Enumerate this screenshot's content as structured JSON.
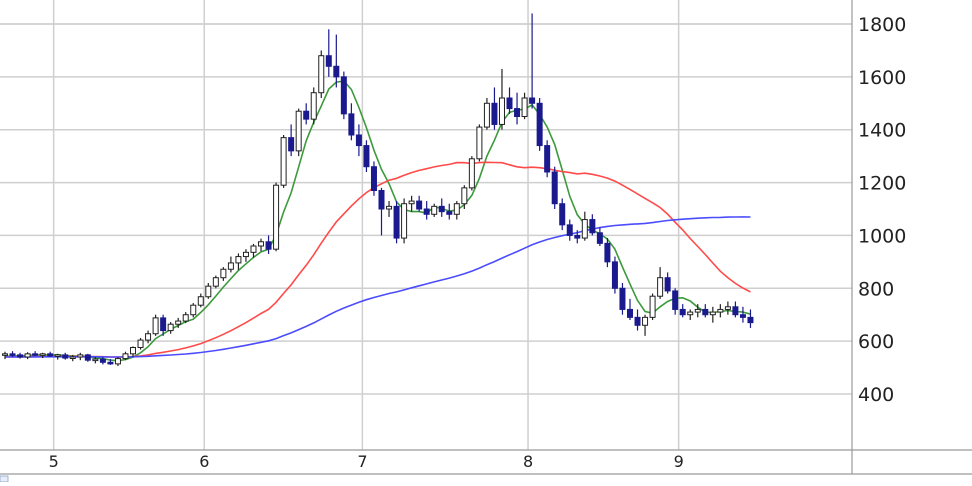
{
  "colors": {
    "background": "#ffffff",
    "grid": "#cfcfcf",
    "frame": "#9a9a9a",
    "candle_up_fill": "#ffffff",
    "candle_down_fill": "#1a1a8e",
    "candle_outline": "#222222",
    "ma_short": "#3c9a3c",
    "ma_mid": "#ff4a4a",
    "ma_long": "#4c4cff"
  },
  "chart_data": {
    "type": "candlestick",
    "x_ticks": [
      "5",
      "6",
      "7",
      "8",
      "9"
    ],
    "y_ticks": [
      400,
      600,
      800,
      1000,
      1200,
      1400,
      1600,
      1800
    ],
    "ylim": [
      150,
      1870
    ],
    "grid": true,
    "bar_count": 100,
    "tick_bar_index": [
      5,
      25,
      46,
      68,
      88
    ],
    "candles": [
      [
        548,
        560,
        532,
        552
      ],
      [
        552,
        562,
        540,
        548
      ],
      [
        548,
        556,
        534,
        540
      ],
      [
        540,
        558,
        532,
        552
      ],
      [
        552,
        562,
        544,
        548
      ],
      [
        548,
        556,
        536,
        552
      ],
      [
        552,
        560,
        540,
        544
      ],
      [
        544,
        552,
        530,
        548
      ],
      [
        548,
        556,
        530,
        536
      ],
      [
        536,
        548,
        524,
        540
      ],
      [
        540,
        556,
        528,
        548
      ],
      [
        548,
        552,
        522,
        528
      ],
      [
        528,
        540,
        516,
        532
      ],
      [
        532,
        540,
        512,
        520
      ],
      [
        520,
        532,
        510,
        514
      ],
      [
        514,
        540,
        506,
        534
      ],
      [
        534,
        560,
        528,
        552
      ],
      [
        552,
        580,
        540,
        576
      ],
      [
        576,
        612,
        568,
        604
      ],
      [
        604,
        640,
        592,
        628
      ],
      [
        628,
        700,
        620,
        688
      ],
      [
        688,
        700,
        620,
        640
      ],
      [
        640,
        672,
        628,
        664
      ],
      [
        664,
        688,
        650,
        676
      ],
      [
        676,
        710,
        668,
        700
      ],
      [
        700,
        744,
        690,
        736
      ],
      [
        736,
        780,
        728,
        768
      ],
      [
        768,
        820,
        760,
        808
      ],
      [
        808,
        848,
        800,
        840
      ],
      [
        840,
        880,
        828,
        872
      ],
      [
        872,
        920,
        860,
        896
      ],
      [
        896,
        932,
        870,
        920
      ],
      [
        920,
        948,
        900,
        936
      ],
      [
        936,
        968,
        916,
        960
      ],
      [
        960,
        988,
        940,
        976
      ],
      [
        976,
        1000,
        930,
        948
      ],
      [
        948,
        1200,
        940,
        1190
      ],
      [
        1190,
        1380,
        1180,
        1370
      ],
      [
        1370,
        1420,
        1300,
        1320
      ],
      [
        1320,
        1480,
        1300,
        1470
      ],
      [
        1470,
        1500,
        1420,
        1440
      ],
      [
        1440,
        1560,
        1420,
        1540
      ],
      [
        1540,
        1700,
        1520,
        1680
      ],
      [
        1680,
        1780,
        1600,
        1640
      ],
      [
        1640,
        1760,
        1560,
        1600
      ],
      [
        1600,
        1620,
        1440,
        1460
      ],
      [
        1460,
        1500,
        1360,
        1380
      ],
      [
        1380,
        1420,
        1300,
        1340
      ],
      [
        1340,
        1360,
        1240,
        1260
      ],
      [
        1260,
        1280,
        1150,
        1170
      ],
      [
        1170,
        1180,
        1000,
        1100
      ],
      [
        1100,
        1130,
        1070,
        1110
      ],
      [
        1110,
        1130,
        970,
        990
      ],
      [
        990,
        1140,
        970,
        1120
      ],
      [
        1120,
        1150,
        1090,
        1130
      ],
      [
        1130,
        1150,
        1090,
        1100
      ],
      [
        1100,
        1130,
        1060,
        1080
      ],
      [
        1080,
        1120,
        1070,
        1110
      ],
      [
        1110,
        1140,
        1070,
        1090
      ],
      [
        1090,
        1120,
        1060,
        1080
      ],
      [
        1080,
        1130,
        1060,
        1120
      ],
      [
        1120,
        1190,
        1100,
        1180
      ],
      [
        1180,
        1300,
        1170,
        1290
      ],
      [
        1290,
        1420,
        1280,
        1410
      ],
      [
        1410,
        1520,
        1400,
        1500
      ],
      [
        1500,
        1560,
        1400,
        1420
      ],
      [
        1420,
        1630,
        1400,
        1520
      ],
      [
        1520,
        1560,
        1460,
        1480
      ],
      [
        1480,
        1540,
        1420,
        1450
      ],
      [
        1450,
        1540,
        1440,
        1520
      ],
      [
        1520,
        1840,
        1480,
        1500
      ],
      [
        1500,
        1520,
        1320,
        1340
      ],
      [
        1340,
        1360,
        1220,
        1240
      ],
      [
        1240,
        1260,
        1100,
        1120
      ],
      [
        1120,
        1140,
        1020,
        1040
      ],
      [
        1040,
        1060,
        980,
        1000
      ],
      [
        1000,
        1020,
        970,
        990
      ],
      [
        990,
        1090,
        980,
        1060
      ],
      [
        1060,
        1080,
        1000,
        1010
      ],
      [
        1010,
        1030,
        960,
        970
      ],
      [
        970,
        990,
        880,
        900
      ],
      [
        900,
        920,
        780,
        800
      ],
      [
        800,
        820,
        700,
        720
      ],
      [
        720,
        760,
        680,
        690
      ],
      [
        690,
        720,
        640,
        660
      ],
      [
        660,
        700,
        620,
        690
      ],
      [
        690,
        780,
        680,
        770
      ],
      [
        770,
        880,
        760,
        840
      ],
      [
        840,
        860,
        780,
        790
      ],
      [
        790,
        800,
        700,
        720
      ],
      [
        720,
        740,
        690,
        700
      ],
      [
        700,
        720,
        680,
        710
      ],
      [
        710,
        740,
        690,
        720
      ],
      [
        720,
        740,
        690,
        700
      ],
      [
        700,
        730,
        670,
        710
      ],
      [
        710,
        740,
        690,
        720
      ],
      [
        720,
        750,
        700,
        730
      ],
      [
        730,
        750,
        690,
        700
      ],
      [
        700,
        730,
        670,
        690
      ],
      [
        690,
        720,
        650,
        670
      ]
    ],
    "series": [
      {
        "name": "",
        "color_key": "ma_short",
        "period": 5
      },
      {
        "name": "",
        "color_key": "ma_mid",
        "period": 25
      },
      {
        "name": "",
        "color_key": "ma_long",
        "period": 75
      }
    ]
  }
}
